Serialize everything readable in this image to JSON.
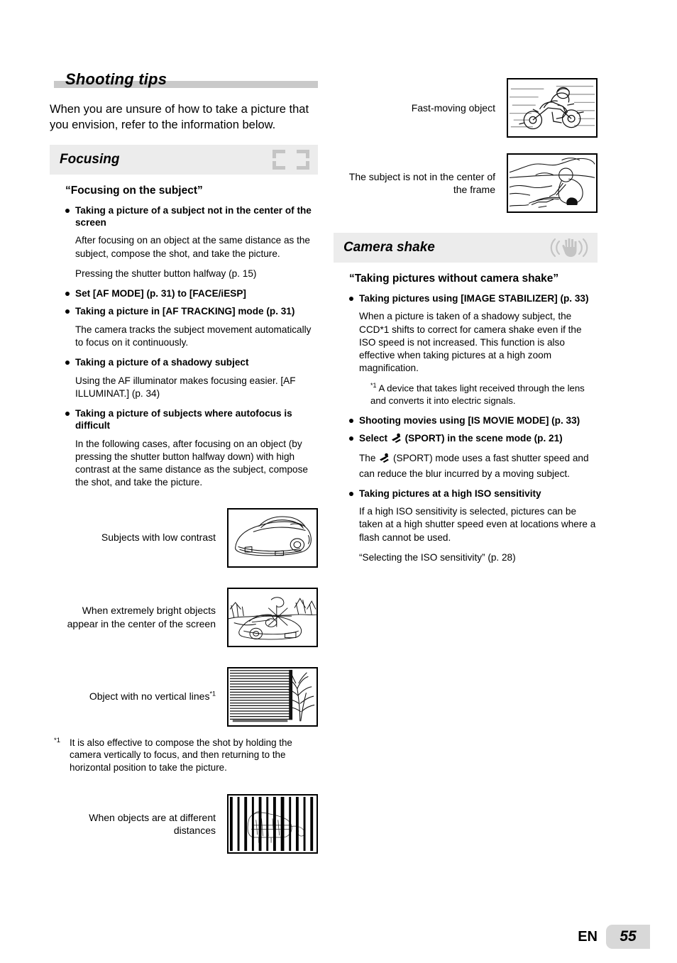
{
  "chapter": {
    "title": "Shooting tips"
  },
  "intro": "When you are unsure of how to take a picture that you envision, refer to the information below.",
  "footer": {
    "lang": "EN",
    "page": "55"
  },
  "colors": {
    "section_bar": "#ececec",
    "title_bar": "#c9c9c9",
    "page_badge": "#d8d8d8",
    "icon_gray": "#c4c4c4"
  },
  "sections": [
    {
      "id": "focusing",
      "title": "Focusing",
      "icon": "af-frame-icon",
      "heading": "“Focusing on the subject”",
      "blocks": [
        {
          "type": "bullet",
          "text": "Taking a picture of a subject not in the center of the screen"
        },
        {
          "type": "para",
          "text": "After focusing on an object at the same distance as the subject, compose the shot, and take the picture."
        },
        {
          "type": "para",
          "text": "Pressing the shutter button halfway (p. 15)"
        },
        {
          "type": "bullet",
          "text": "Set [AF MODE] (p. 31) to [FACE/iESP]"
        },
        {
          "type": "bullet",
          "text": "Taking a picture in [AF TRACKING] mode (p. 31)"
        },
        {
          "type": "para",
          "text": "The camera tracks the subject movement automatically to focus on it continuously."
        },
        {
          "type": "bullet",
          "text": "Taking a picture of a shadowy subject"
        },
        {
          "type": "para",
          "text": "Using the AF illuminator makes focusing easier. [AF ILLUMINAT.] (p. 34)"
        },
        {
          "type": "bullet",
          "text": "Taking a picture of subjects where autofocus is difficult"
        },
        {
          "type": "para",
          "text": "In the following cases, after focusing on an object (by pressing the shutter button halfway down) with high contrast at the same distance as the subject, compose the shot, and take the picture."
        }
      ],
      "figures": [
        {
          "caption": "Subjects with low contrast",
          "illustration": "car-low-contrast"
        },
        {
          "caption": "When extremely bright objects appear in the center of the screen",
          "illustration": "car-backlit-sun"
        },
        {
          "caption": "Object with no vertical lines",
          "caption_mark": "*1",
          "illustration": "horizontal-blinds-plant"
        }
      ],
      "footnote": {
        "mark": "*1",
        "text": "It is also effective to compose the shot by holding the camera vertically to focus, and then returning to the horizontal position to take the picture."
      },
      "figures_after_footnote": [
        {
          "caption": "When objects are at different distances",
          "illustration": "tiger-behind-bars"
        }
      ]
    },
    {
      "id": "camera-shake",
      "title": "Camera shake",
      "icon": "shaking-hand-icon",
      "heading": "“Taking pictures without camera shake”",
      "blocks": [
        {
          "type": "bullet",
          "text": "Taking pictures using [IMAGE STABILIZER] (p. 33)"
        },
        {
          "type": "para",
          "text": "When a picture is taken of a shadowy subject, the CCD*1 shifts to correct for camera shake even if the ISO speed is not increased. This function is also effective when taking pictures at a high zoom magnification."
        },
        {
          "type": "note",
          "mark": "*1",
          "text": "A device that takes light received through the lens and converts it into electric signals."
        },
        {
          "type": "bullet",
          "text": "Shooting movies using [IS MOVIE MODE] (p. 33)"
        },
        {
          "type": "bullet",
          "text": "Select  (SPORT) in the scene mode (p. 21)",
          "has_sport_icon": true
        },
        {
          "type": "para",
          "text": "The  (SPORT) mode uses a fast shutter speed and can reduce the blur incurred by a moving subject.",
          "has_sport_icon": true
        },
        {
          "type": "bullet",
          "text": "Taking pictures at a high ISO sensitivity"
        },
        {
          "type": "para",
          "text": "If a high ISO sensitivity is selected, pictures can be taken at a high shutter speed even at locations where a flash cannot be used."
        },
        {
          "type": "para",
          "text": "“Selecting the ISO sensitivity” (p. 28)"
        }
      ]
    }
  ],
  "right_figures": [
    {
      "caption": "Fast-moving object",
      "illustration": "motorcycle-motion-blur"
    },
    {
      "caption": "The subject is not in the center of the frame",
      "illustration": "person-sitting-landscape"
    }
  ]
}
